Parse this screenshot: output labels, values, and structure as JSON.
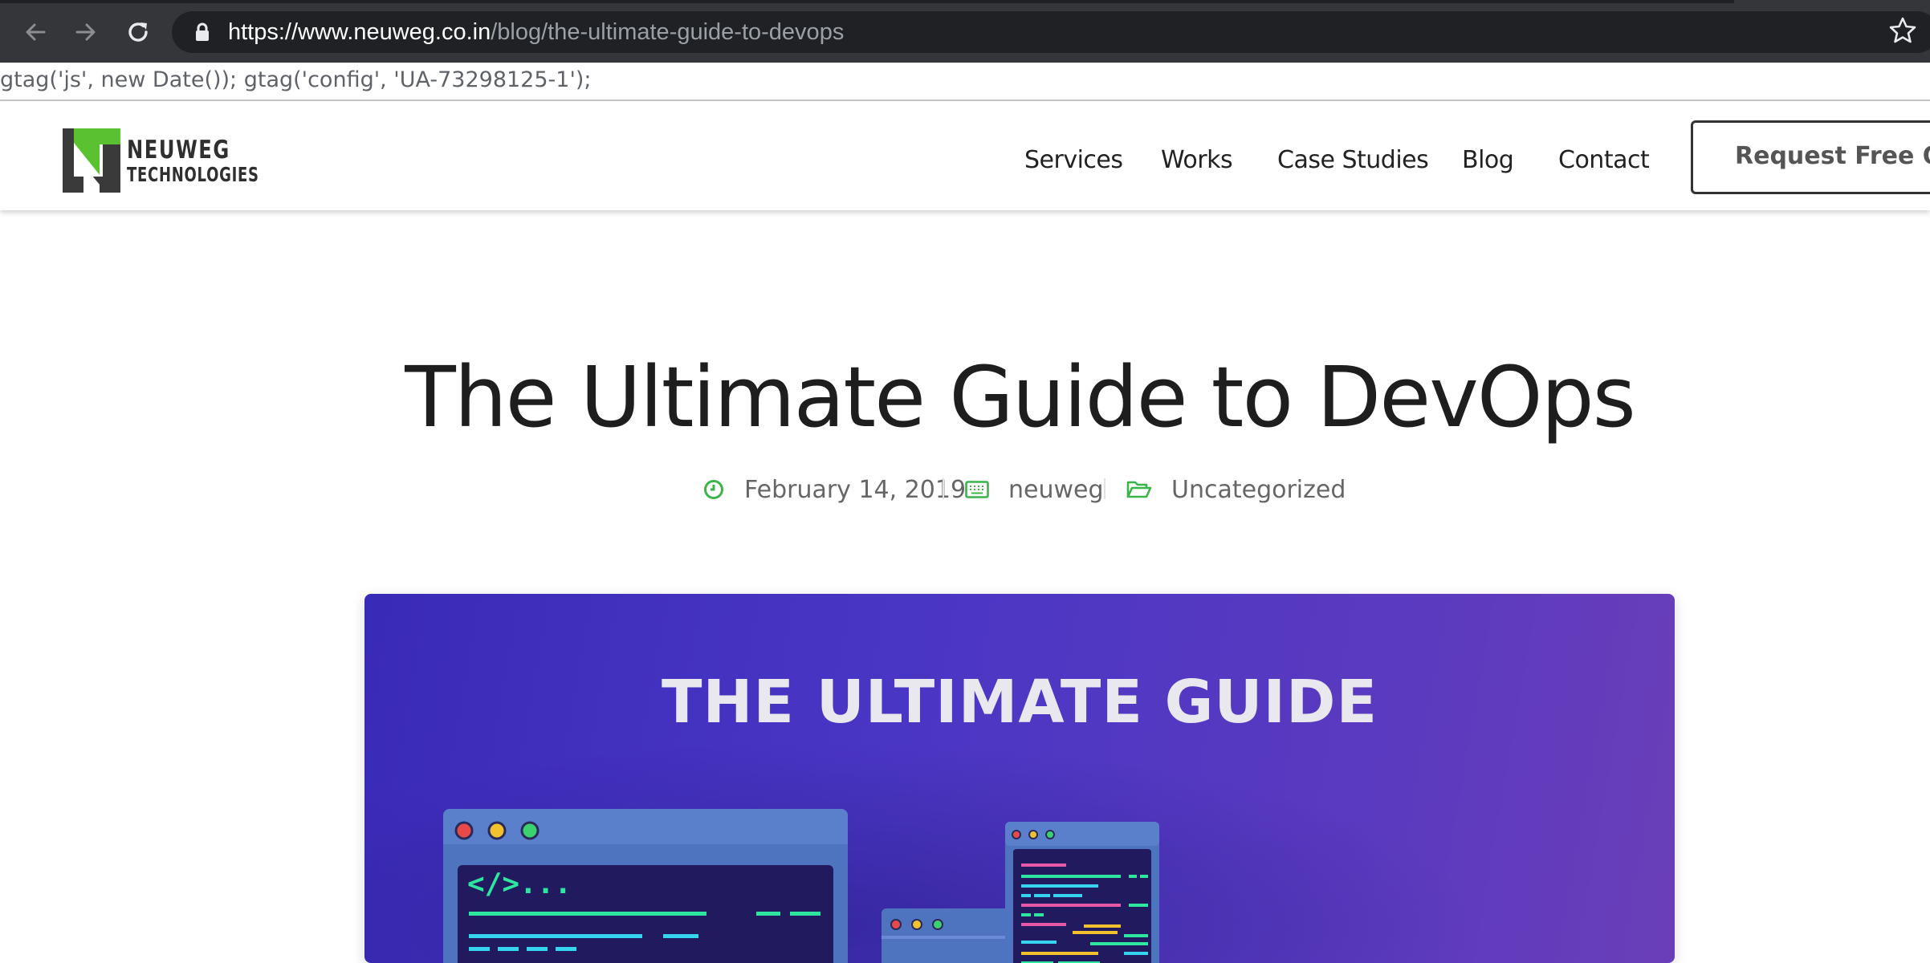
{
  "browser": {
    "url_host": "https://www.neuweg.co.in",
    "url_path": "/blog/the-ultimate-guide-to-devops",
    "icons": [
      "back-arrow-icon",
      "forward-arrow-icon",
      "reload-icon",
      "lock-icon",
      "bookmark-star-icon"
    ]
  },
  "page_leak_text": "gtag('js', new Date()); gtag('config', 'UA-73298125-1');",
  "header": {
    "logo_line1": "NEUWEG",
    "logo_line2": "TECHNOLOGIES",
    "nav": [
      "Services",
      "Works",
      "Case Studies",
      "Blog",
      "Contact"
    ],
    "cta_label": "Request Free Quo"
  },
  "article": {
    "title": "The Ultimate Guide to DevOps",
    "date": "February 14, 2019",
    "author": "neuweg",
    "category": "Uncategorized"
  },
  "hero": {
    "title": "THE ULTIMATE GUIDE",
    "code_tag": "</>..."
  },
  "colors": {
    "accent_green": "#3bb44a",
    "hero_purple": "#4a36c4",
    "chrome_dark": "#35363a"
  }
}
